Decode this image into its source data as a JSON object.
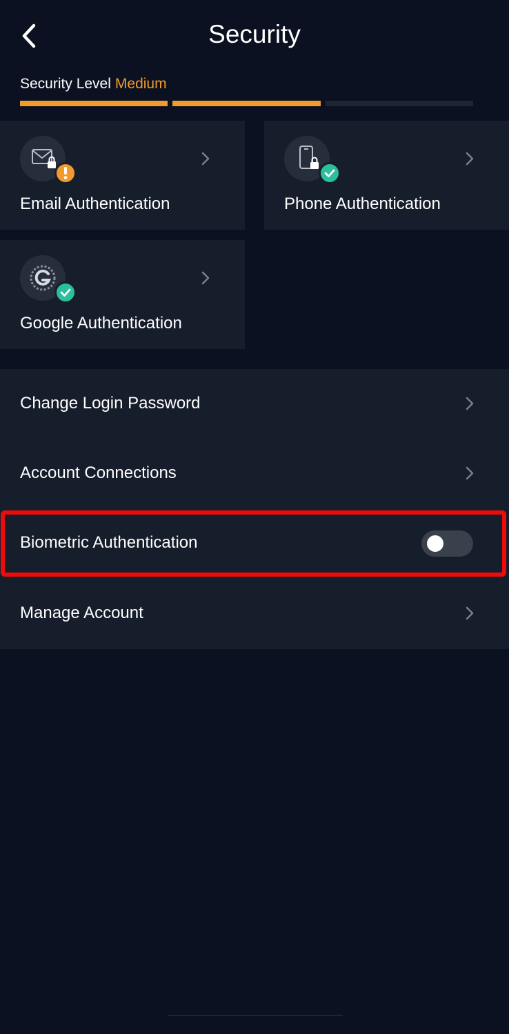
{
  "header": {
    "title": "Security",
    "back_icon": "chevron-left-icon"
  },
  "security_level": {
    "label": "Security Level",
    "value": "Medium",
    "filled_segments": 2,
    "total_segments": 3,
    "accent_color": "#f29a2e"
  },
  "auth_cards": [
    {
      "label": "Email Authentication",
      "icon": "envelope-lock-icon",
      "status": "warning",
      "status_icon": "exclamation-icon"
    },
    {
      "label": "Phone Authentication",
      "icon": "phone-lock-icon",
      "status": "verified",
      "status_icon": "check-icon"
    },
    {
      "label": "Google Authentication",
      "icon": "google-authenticator-icon",
      "status": "verified",
      "status_icon": "check-icon"
    }
  ],
  "settings": {
    "change_password": "Change Login Password",
    "account_connections": "Account Connections",
    "biometric": "Biometric Authentication",
    "biometric_enabled": false,
    "manage_account": "Manage Account"
  },
  "colors": {
    "background": "#0b1120",
    "card": "#161d2b",
    "warning": "#f29a2e",
    "verified": "#2bbf9b",
    "highlight": "#ee0b0b"
  }
}
